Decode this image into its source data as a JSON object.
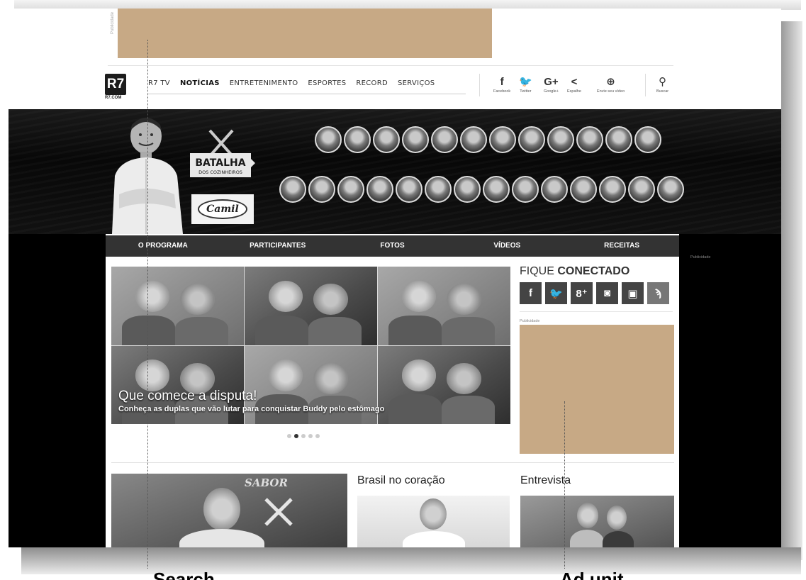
{
  "top_banner": {
    "vertical_label": "Publicidade"
  },
  "logo": {
    "mark": "R7",
    "sub": "R7.COM"
  },
  "top_nav": [
    {
      "label": "R7 TV",
      "active": false
    },
    {
      "label": "NOTÍCIAS",
      "active": true
    },
    {
      "label": "ENTRETENIMENTO",
      "active": false
    },
    {
      "label": "ESPORTES",
      "active": false
    },
    {
      "label": "RECORD",
      "active": false
    },
    {
      "label": "SERVIÇOS",
      "active": false
    }
  ],
  "share_tools": [
    {
      "icon": "facebook-icon",
      "glyph": "f",
      "label": "Facebook"
    },
    {
      "icon": "twitter-icon",
      "glyph": "🐦",
      "label": "Twitter"
    },
    {
      "icon": "google-plus-icon",
      "glyph": "G+",
      "label": "Google+"
    },
    {
      "icon": "share-icon",
      "glyph": "<",
      "label": "Espalhe"
    },
    {
      "icon": "upload-video-icon",
      "glyph": "⊕",
      "label": "Envie seu vídeo"
    },
    {
      "icon": "search-icon",
      "glyph": "⚲",
      "label": "Buscar"
    }
  ],
  "hero": {
    "show_logo_top": "BATALHA",
    "show_logo_small": "DOS COZINHEIROS",
    "sponsor": "Camil"
  },
  "sub_nav": [
    "O PROGRAMA",
    "PARTICIPANTES",
    "FOTOS",
    "VÍDEOS",
    "RECEITAS"
  ],
  "side_publicidade": "Publicidade",
  "carousel": {
    "title": "Que comece a disputa!",
    "subtitle": "Conheça as duplas que vão lutar para conquistar Buddy pelo estômago",
    "dot_count": 5,
    "active_dot": 1
  },
  "fique_conectado": {
    "light": "FIQUE ",
    "bold": "CONECTADO",
    "socials": [
      {
        "icon": "facebook-icon",
        "glyph": "f"
      },
      {
        "icon": "twitter-icon",
        "glyph": "🐦"
      },
      {
        "icon": "google-plus-icon",
        "glyph": "8⁺"
      },
      {
        "icon": "instagram-icon",
        "glyph": "◙"
      },
      {
        "icon": "youtube-icon",
        "glyph": "▣"
      },
      {
        "icon": "rss-icon",
        "glyph": "ϡ"
      }
    ]
  },
  "ad_label": "Publicidade",
  "sections": [
    {
      "title": ""
    },
    {
      "title": "Brasil no coração"
    },
    {
      "title": "Entrevista"
    }
  ],
  "sabor_sign": "SABOR",
  "bottom_labels": {
    "left": "Search",
    "right": "Ad unit"
  },
  "colors": {
    "ad_placeholder": "#c7a985",
    "nav_bar": "#333333",
    "hero_bg": "#0a0a0a"
  }
}
